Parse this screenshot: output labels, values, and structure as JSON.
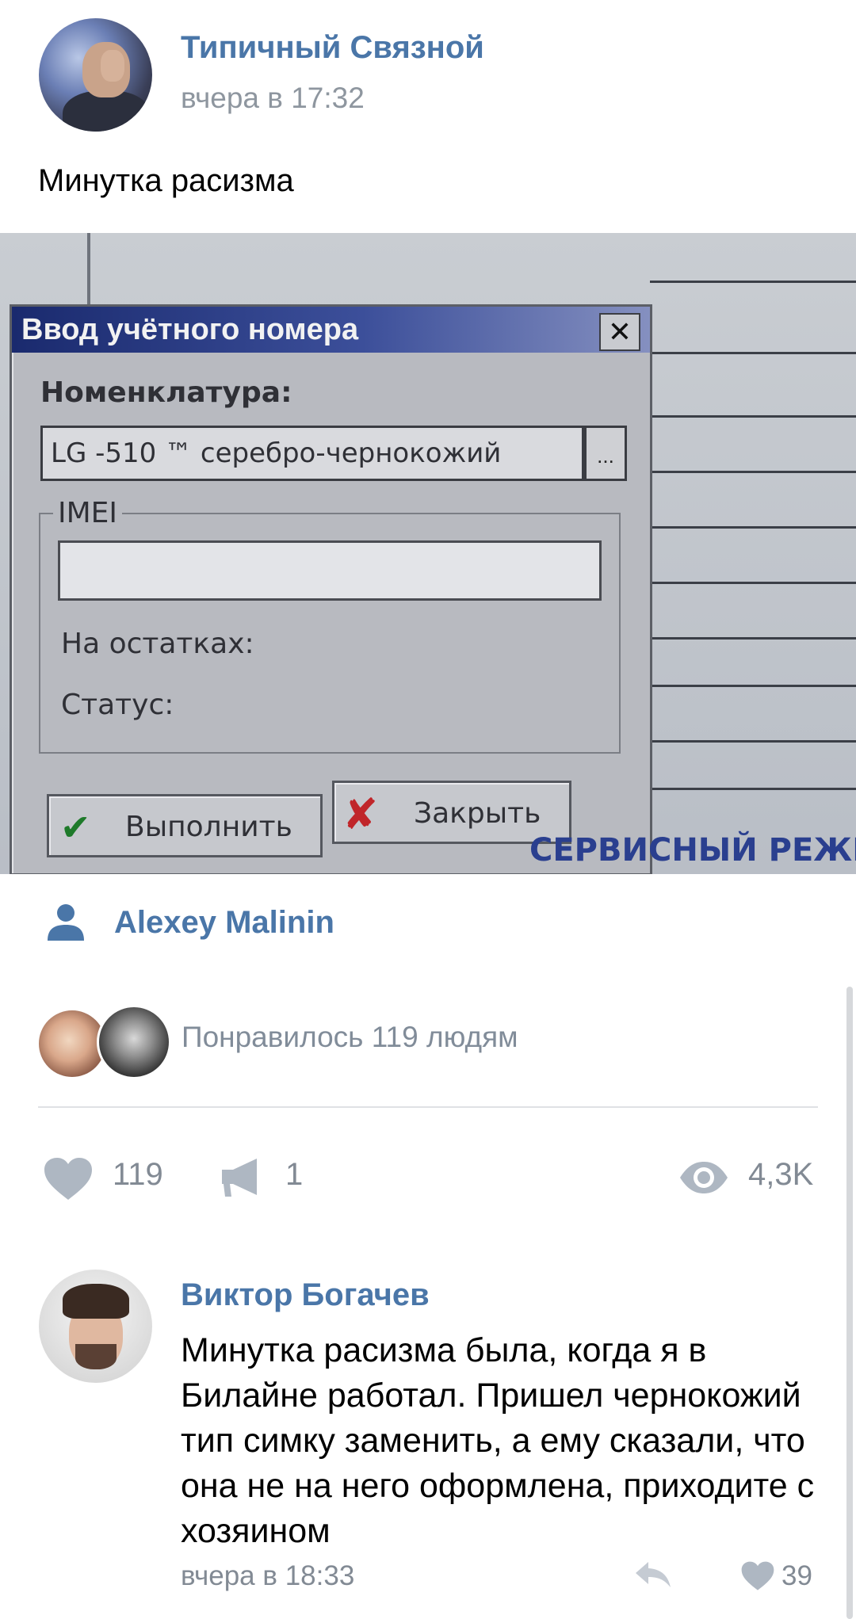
{
  "post": {
    "author": "Типичный Связной",
    "time": "вчера в 17:32",
    "text": "Минутка расизма",
    "photo": {
      "dialog_title": "Ввод учётного номера",
      "close_glyph": "✕",
      "nomenclature_label": "Номенклатура:",
      "nomenclature_value": "LG -510 ™ серебро-чернокожий",
      "browse_button": "...",
      "imei_label": "IMEI",
      "imei_value": "",
      "remainder_label": "На остатках:",
      "status_label": "Статус:",
      "execute_button": "Выполнить",
      "close_button": "Закрыть",
      "mode_text": "СЕРВИСНЫЙ РЕЖИМ"
    },
    "owner_name": "Alexey Malinin",
    "likes_summary": "Понравилось 119 людям",
    "stats": {
      "likes": "119",
      "shares": "1",
      "views": "4,3K"
    }
  },
  "comment": {
    "author": "Виктор Богачев",
    "text": "Минутка расизма была, когда я в Билайне работал. Пришел чернокожий тип симку заменить, а ему сказали, что она не на него оформлена, приходите с хозяином",
    "time": "вчера в 18:33",
    "likes": "39"
  },
  "icons": {
    "user": "user-icon",
    "like": "heart-icon",
    "share": "megaphone-icon",
    "views": "eye-icon",
    "reply": "reply-arrow-icon"
  },
  "colors": {
    "link": "#4a76a8",
    "secondary_text": "#828a94",
    "icon_gray": "#aeb7c2"
  }
}
